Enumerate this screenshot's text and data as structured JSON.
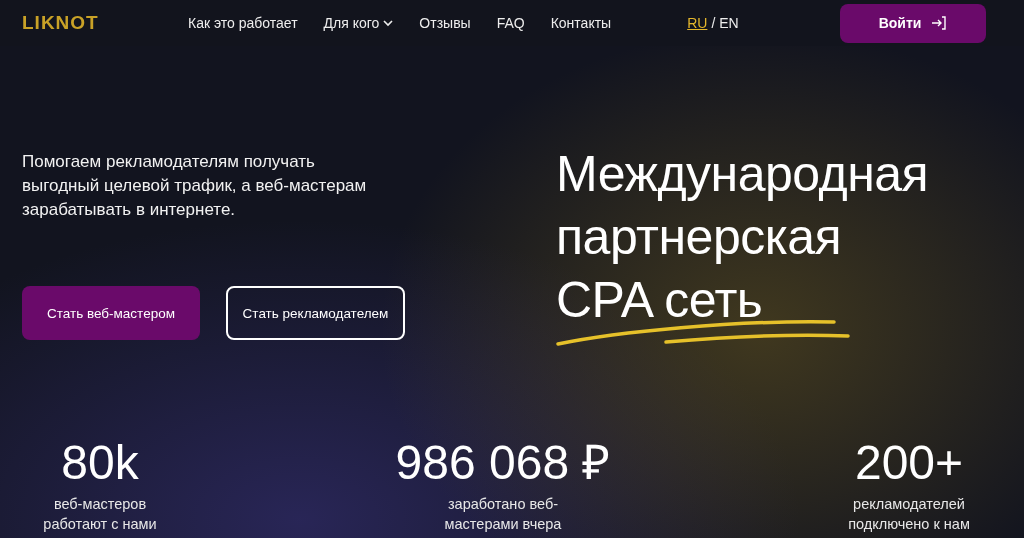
{
  "header": {
    "logo": "LIKNOT",
    "nav": [
      {
        "label": "Как это работает",
        "dropdown": false
      },
      {
        "label": "Для кого",
        "dropdown": true
      },
      {
        "label": "Отзывы",
        "dropdown": false
      },
      {
        "label": "FAQ",
        "dropdown": false
      },
      {
        "label": "Контакты",
        "dropdown": false
      }
    ],
    "languages": [
      {
        "label": "RU",
        "selected": true
      },
      {
        "label": "EN",
        "selected": false
      }
    ],
    "separator": "/",
    "login": "Войти"
  },
  "hero": {
    "subtitle": "Помогаем рекламодателям получать\nвыгодный целевой трафик, а веб-мастерам\nзарабатывать в интернете.",
    "buttons": [
      {
        "label": "Стать веб-мастером",
        "kind": "primary"
      },
      {
        "label": "Стать рекламодателем",
        "kind": "outline"
      }
    ],
    "title": "Международная\nпартнерская\nCPA сеть"
  },
  "stats": [
    {
      "value": "80k",
      "label": "веб-мастеров\nработают с нами"
    },
    {
      "value": "986 068 ₽",
      "label": "заработано веб-\nмастерами вчера"
    },
    {
      "value": "200+",
      "label": "рекламодателей\nподключено к нам"
    }
  ]
}
